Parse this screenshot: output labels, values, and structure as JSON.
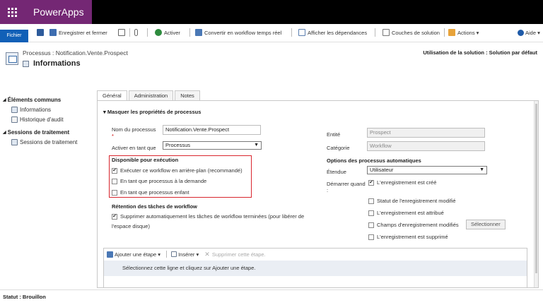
{
  "app": {
    "name": "PowerApps"
  },
  "commandbar": {
    "file": "Fichier",
    "save_close": "Enregistrer et fermer",
    "activate": "Activer",
    "convert": "Convertir en workflow temps réel",
    "dependencies": "Afficher les dépendances",
    "layers": "Couches de solution",
    "actions": "Actions ▾",
    "help": "Aide ▾"
  },
  "header": {
    "caption": "Processus : Notification.Vente.Prospect",
    "title": "Informations",
    "solution_usage": "Utilisation de la solution : Solution par défaut"
  },
  "nav": {
    "group1": "Éléments communs",
    "items1": [
      "Informations",
      "Historique d'audit"
    ],
    "group2": "Sessions de traitement",
    "items2": [
      "Sessions de traitement"
    ]
  },
  "tabs": [
    "Général",
    "Administration",
    "Notes"
  ],
  "form": {
    "section_title": "Masquer les propriétés de processus",
    "process_name_label": "Nom du processus",
    "process_name_value": "Notification.Vente.Prospect",
    "activate_as_label": "Activer en tant que",
    "activate_as_value": "Processus",
    "entity_label": "Entité",
    "entity_value": "Prospect",
    "category_label": "Catégorie",
    "category_value": "Workflow",
    "available_title": "Disponible pour exécution",
    "available_options": [
      "Exécuter ce workflow en arrière-plan (recommandé)",
      "En tant que processus à la demande",
      "En tant que processus enfant"
    ],
    "retention_title": "Rétention des tâches de workflow",
    "retention_line1": "Supprimer automatiquement les tâches de workflow terminées (pour libérer de",
    "retention_line2": "l'espace disque)",
    "auto_title": "Options des processus automatiques",
    "scope_label": "Étendue",
    "scope_value": "Utilisateur",
    "start_when_label": "Démarrer quand",
    "start_when_colon": ":",
    "triggers": [
      "L'enregistrement est créé",
      "Statut de l'enregistrement modifié",
      "L'enregistrement est attribué",
      "Champs d'enregistrement modifiés",
      "L'enregistrement est supprimé"
    ],
    "select_button": "Sélectionner"
  },
  "steps": {
    "add_step": "Ajouter une étape ▾",
    "insert": "Insérer ▾",
    "delete": "Supprimer cette étape.",
    "hint": "Sélectionnez cette ligne et cliquez sur Ajouter une étape."
  },
  "status": {
    "text": "Statut : Brouillon"
  },
  "colors": {
    "brand": "#742774",
    "accent": "#1160b7",
    "highlight": "#d9262e"
  }
}
